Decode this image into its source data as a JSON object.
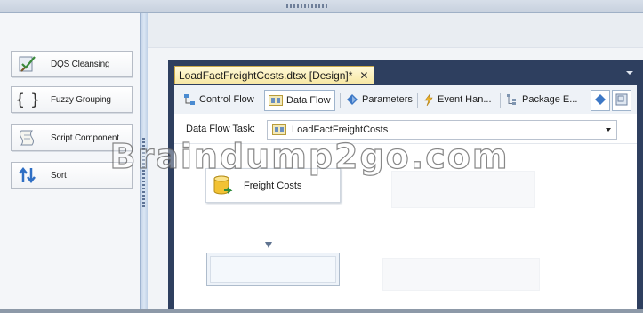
{
  "toolbox": {
    "items": [
      {
        "label": "DQS Cleansing",
        "icon": "dqs-cleansing-icon"
      },
      {
        "label": "Fuzzy Grouping",
        "icon": "fuzzy-grouping-icon"
      },
      {
        "label": "Script Component",
        "icon": "script-component-icon"
      },
      {
        "label": "Sort",
        "icon": "sort-icon"
      }
    ]
  },
  "document_tab": {
    "title": "LoadFactFreightCosts.dtsx [Design]*",
    "close_glyph": "✕"
  },
  "designer_tabs": [
    {
      "label": "Control Flow",
      "icon": "control-flow-icon",
      "active": false
    },
    {
      "label": "Data Flow",
      "icon": "data-flow-icon",
      "active": true
    },
    {
      "label": "Parameters",
      "icon": "parameters-icon",
      "active": false
    },
    {
      "label": "Event Han...",
      "icon": "event-handlers-icon",
      "active": false
    },
    {
      "label": "Package E...",
      "icon": "package-explorer-icon",
      "active": false
    }
  ],
  "data_flow_task": {
    "label": "Data Flow Task:",
    "selected": "LoadFactFreightCosts"
  },
  "components": [
    {
      "label": "Freight Costs",
      "icon": "database-source-icon"
    }
  ],
  "watermark": "Braindump2go.com",
  "colors": {
    "designer_frame": "#2e3f5f",
    "active_doc_tab": "#f7e7a1",
    "canvas": "#ffffff"
  }
}
